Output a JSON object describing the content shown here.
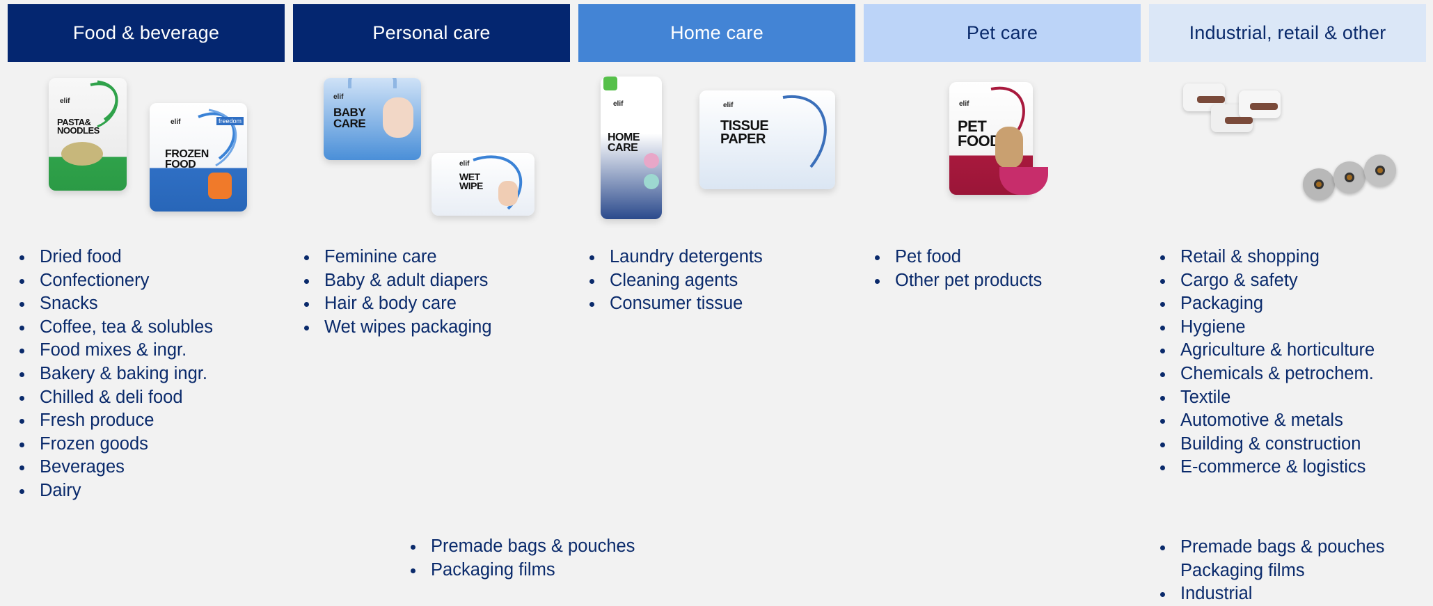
{
  "columns": [
    {
      "header": "Food & beverage",
      "items": [
        "Dried food",
        "Confectionery",
        "Snacks",
        "Coffee, tea & solubles",
        "Food mixes & ingr.",
        "Bakery & baking ingr.",
        "Chilled & deli food",
        "Fresh produce",
        "Frozen goods",
        "Beverages",
        "Dairy"
      ],
      "packages": [
        "PASTA& NOODLES",
        "FROZEN FOOD"
      ]
    },
    {
      "header": "Personal care",
      "items": [
        "Feminine care",
        "Baby & adult diapers",
        "Hair & body care",
        "Wet wipes packaging"
      ],
      "packages": [
        "BABY CARE",
        "WET WIPE"
      ]
    },
    {
      "header": "Home care",
      "items": [
        "Laundry detergents",
        "Cleaning agents",
        "Consumer tissue"
      ],
      "packages": [
        "HOME CARE",
        "TISSUE PAPER"
      ]
    },
    {
      "header": "Pet care",
      "items": [
        "Pet food",
        "Other pet products"
      ],
      "packages": [
        "PET FOOD"
      ]
    },
    {
      "header": "Industrial, retail & other",
      "items": [
        "Retail & shopping",
        "Cargo & safety",
        "Packaging",
        "Hygiene",
        "Agriculture & horticulture",
        "Chemicals & petrochem.",
        "Textile",
        "Automotive & metals",
        "Building & construction",
        "E-commerce & logistics"
      ]
    }
  ],
  "bottom_left": [
    "Premade bags & pouches",
    "Packaging films"
  ],
  "bottom_right": [
    "Premade bags & pouches",
    "Packaging films",
    "Industrial"
  ],
  "brand": "elif",
  "brand_sub": "freedom",
  "colors": {
    "dark": "#042670",
    "mid": "#4384d5",
    "light": "#bcd4f8",
    "pale": "#dbe7f7",
    "text": "#0a2a6b"
  }
}
